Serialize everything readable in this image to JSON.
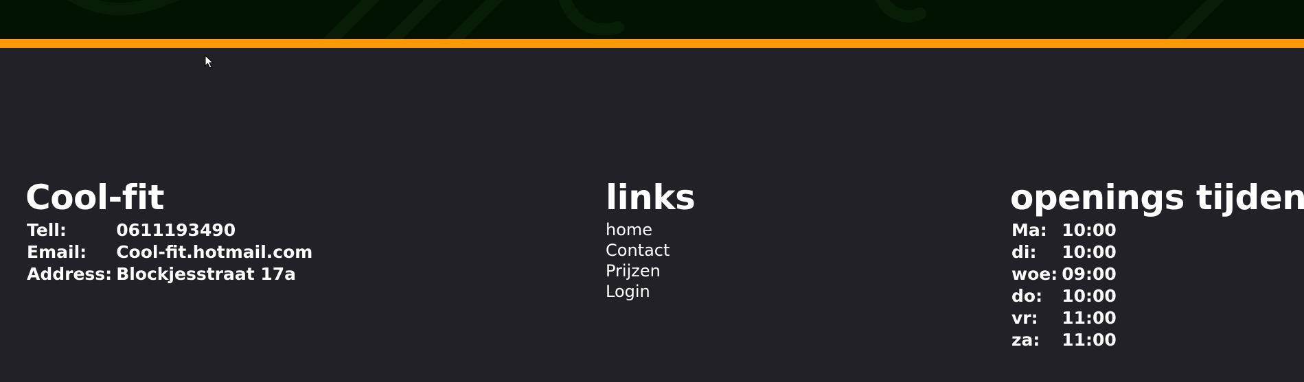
{
  "colors": {
    "background": "#222128",
    "hero": "#031302",
    "accent": "#ff9900",
    "text": "#ffffff"
  },
  "brand": {
    "title": "Cool-fit",
    "details": [
      {
        "label": "Tell:",
        "value": "0611193490"
      },
      {
        "label": "Email:",
        "value": "Cool-fit.hotmail.com"
      },
      {
        "label": "Address:",
        "value": "Blockjesstraat 17a"
      }
    ]
  },
  "links": {
    "title": "links",
    "items": [
      {
        "label": "home"
      },
      {
        "label": "Contact"
      },
      {
        "label": "Prijzen"
      },
      {
        "label": "Login"
      }
    ]
  },
  "hours": {
    "title": "openings tijden",
    "days": [
      {
        "day": "Ma:",
        "time": "10:00"
      },
      {
        "day": "di:",
        "time": "10:00"
      },
      {
        "day": "woe:",
        "time": "09:00"
      },
      {
        "day": "do:",
        "time": "10:00"
      },
      {
        "day": "vr:",
        "time": "11:00"
      },
      {
        "day": "za:",
        "time": "11:00"
      }
    ]
  },
  "icons": {
    "cursor": "mouse-pointer-icon"
  }
}
